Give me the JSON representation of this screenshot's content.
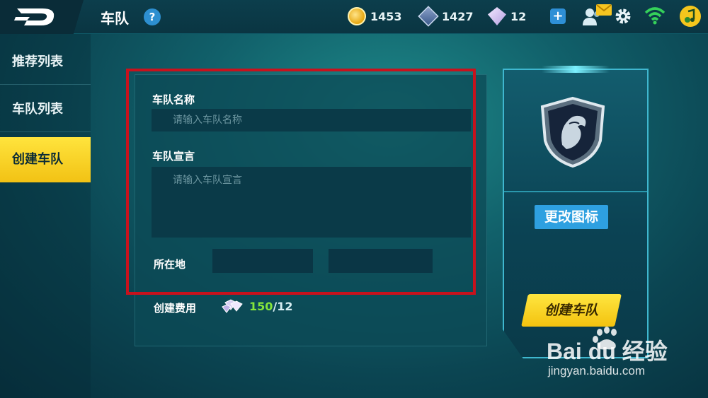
{
  "header": {
    "title": "车队",
    "help_label": "?",
    "resources": [
      {
        "name": "gold-coin",
        "value": "1453"
      },
      {
        "name": "ticket",
        "value": "1427"
      },
      {
        "name": "diamond",
        "value": "12"
      }
    ],
    "add_label": "+"
  },
  "sidebar": {
    "items": [
      {
        "label": "推荐列表",
        "active": false
      },
      {
        "label": "车队列表",
        "active": false
      },
      {
        "label": "创建车队",
        "active": true
      }
    ]
  },
  "form": {
    "name_label": "车队名称",
    "name_placeholder": "请输入车队名称",
    "name_value": "",
    "declaration_label": "车队宣言",
    "declaration_placeholder": "请输入车队宣言",
    "declaration_value": "",
    "location_label": "所在地",
    "location_province": "",
    "location_city": "",
    "cost_label": "创建费用",
    "cost_have": "150",
    "cost_sep": "/",
    "cost_required": "12"
  },
  "right_panel": {
    "change_icon_label": "更改图标",
    "create_label": "创建车队"
  },
  "watermark": {
    "brand": "Bai du 经验",
    "url": "jingyan.baidu.com"
  },
  "colors": {
    "accent_yellow": "#f6cf22",
    "accent_blue": "#2ea0e0",
    "highlight_red": "#c8121d",
    "cost_green": "#85e63b"
  }
}
